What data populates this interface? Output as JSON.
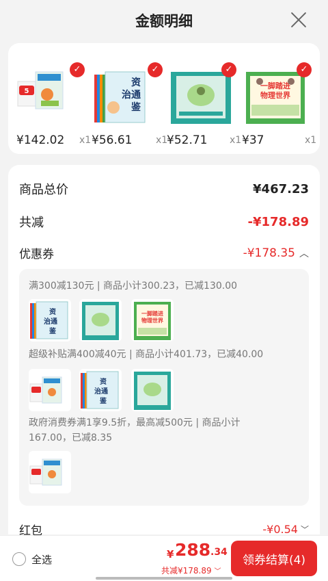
{
  "header": {
    "title": "金额明细"
  },
  "products": [
    {
      "price": "¥142.02",
      "qty": "x1",
      "icon": "kids-magazine-bundle"
    },
    {
      "price": "¥56.61",
      "qty": "x1",
      "icon": "zizhi-tongjian-books"
    },
    {
      "price": "¥52.71",
      "qty": "x1",
      "icon": "green-book-box-set"
    },
    {
      "price": "¥37",
      "qty": "x1",
      "icon": "physics-world-book-set"
    }
  ],
  "summary": {
    "total_label": "商品总价",
    "total_value": "¥467.23",
    "reduce_label": "共减",
    "reduce_value": "-¥178.89",
    "coupon_label": "优惠券",
    "coupon_value": "-¥178.35",
    "redpacket_label": "红包",
    "redpacket_value": "-¥0.54"
  },
  "coupons": [
    {
      "text": "满300减130元 | 商品小计300.23，已减130.00"
    },
    {
      "text": "超级补贴满400减40元 | 商品小计401.73，已减40.00"
    },
    {
      "text_line1": "政府消费券满1享9.5折，最高减500元 | 商品小计",
      "text_line2": "167.00，已减8.35"
    }
  ],
  "bottom": {
    "select_all": "全选",
    "total_yen": "¥",
    "total_main": "288",
    "total_dec": ".34",
    "total_sub": "共减¥178.89",
    "checkout": "领券结算(4)"
  },
  "colors": {
    "accent": "#e62a2a",
    "background": "#f3f3f3"
  }
}
